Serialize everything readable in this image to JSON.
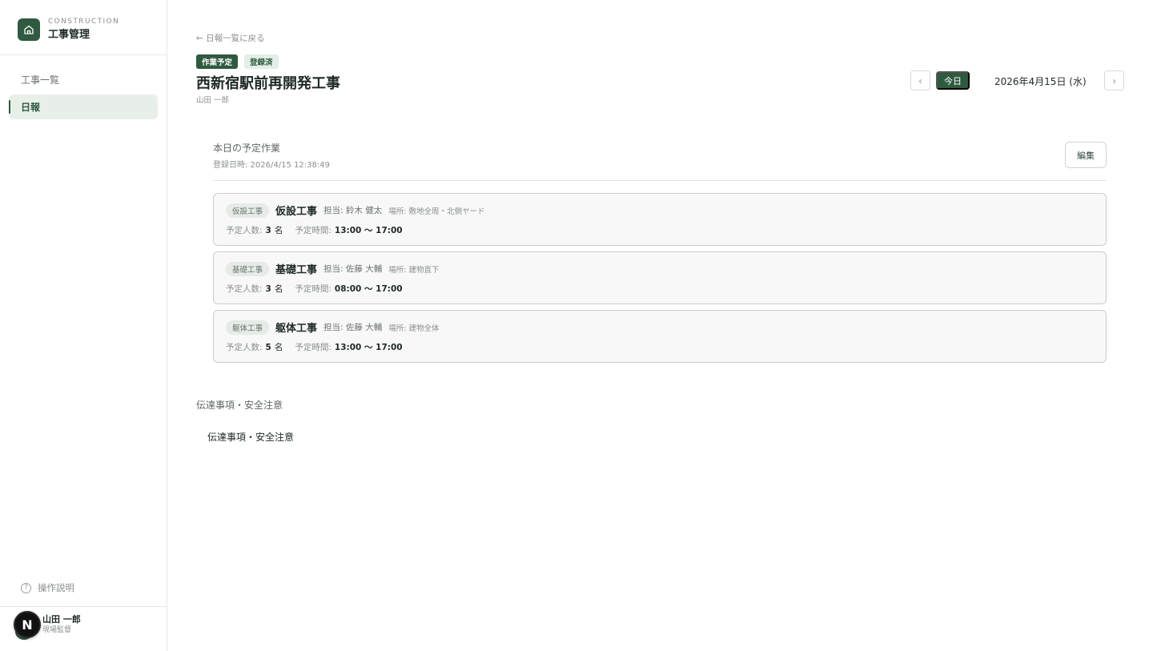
{
  "brand": {
    "sub": "CONSTRUCTION",
    "title": "工事管理",
    "icon": "home-icon"
  },
  "sidebar": {
    "items": [
      {
        "label": "工事一覧",
        "active": false
      },
      {
        "label": "日報",
        "active": true
      }
    ],
    "help_label": "操作説明",
    "help_icon": "?"
  },
  "user": {
    "initial": "N",
    "name": "山田 一郎",
    "role": "現場監督"
  },
  "header": {
    "back_link": "← 日報一覧に戻る",
    "tags": [
      "作業予定",
      "登録済"
    ],
    "title": "西新宿駅前再開発工事",
    "owner": "山田 一郎"
  },
  "date_nav": {
    "prev": "‹",
    "today": "今日",
    "date": "2026年4月15日 (水)",
    "next": "›"
  },
  "plan": {
    "title": "本日の予定作業",
    "registered": "登録日時: 2026/4/15 12:38:49",
    "edit_label": "編集",
    "people_label": "予定人数:",
    "time_label": "予定時間:",
    "unit_people": "名",
    "tasks": [
      {
        "category": "仮設工事",
        "name": "仮設工事",
        "assignee": "担当: 鈴木 健太",
        "place": "場所: 敷地全周・北側ヤード",
        "people": "3",
        "time": "13:00 〜 17:00"
      },
      {
        "category": "基礎工事",
        "name": "基礎工事",
        "assignee": "担当: 佐藤 大輔",
        "place": "場所: 建物直下",
        "people": "3",
        "time": "08:00 〜 17:00"
      },
      {
        "category": "躯体工事",
        "name": "躯体工事",
        "assignee": "担当: 佐藤 大輔",
        "place": "場所: 建物全体",
        "people": "5",
        "time": "13:00 〜 17:00"
      }
    ]
  },
  "notes": {
    "title": "伝達事項・安全注意",
    "body": "伝達事項・安全注意"
  },
  "colors": {
    "accent": "#2f5a3f",
    "accent_light": "#e8efe9",
    "border": "#c9cfcb"
  }
}
